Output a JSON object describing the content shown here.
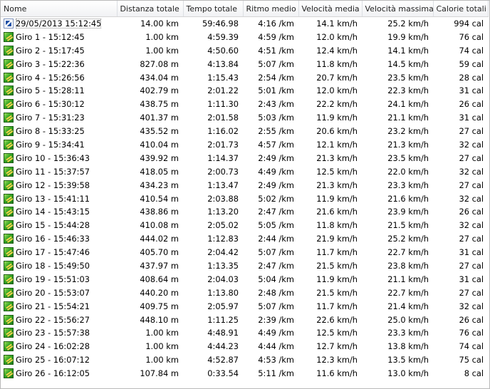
{
  "columns": [
    "Nome",
    "Distanza totale",
    "Tempo totale",
    "Ritmo medio",
    "Velocità media",
    "Velocità massima",
    "Calorie totali"
  ],
  "rows": [
    {
      "name": "29/05/2013 15:12:45",
      "dist": "14.00 km",
      "time": "59:46.98",
      "pace": "4:16 /km",
      "avg": "14.1 km/h",
      "max": "25.2 km/h",
      "cal": "994 cal",
      "icon": "runner-icon"
    },
    {
      "name": "Giro 1 - 15:12:45",
      "dist": "1.00 km",
      "time": "4:59.39",
      "pace": "4:59 /km",
      "avg": "12.0 km/h",
      "max": "19.9 km/h",
      "cal": "76 cal",
      "icon": "lap-icon"
    },
    {
      "name": "Giro 2 - 15:17:45",
      "dist": "1.00 km",
      "time": "4:50.60",
      "pace": "4:51 /km",
      "avg": "12.4 km/h",
      "max": "14.1 km/h",
      "cal": "74 cal",
      "icon": "lap-icon"
    },
    {
      "name": "Giro 3 - 15:22:36",
      "dist": "827.08 m",
      "time": "4:13.84",
      "pace": "5:07 /km",
      "avg": "11.8 km/h",
      "max": "14.5 km/h",
      "cal": "59 cal",
      "icon": "lap-icon"
    },
    {
      "name": "Giro 4 - 15:26:56",
      "dist": "434.04 m",
      "time": "1:15.43",
      "pace": "2:54 /km",
      "avg": "20.7 km/h",
      "max": "23.5 km/h",
      "cal": "28 cal",
      "icon": "lap-icon"
    },
    {
      "name": "Giro 5 - 15:28:11",
      "dist": "402.79 m",
      "time": "2:01.22",
      "pace": "5:01 /km",
      "avg": "12.0 km/h",
      "max": "22.3 km/h",
      "cal": "31 cal",
      "icon": "lap-icon"
    },
    {
      "name": "Giro 6 - 15:30:12",
      "dist": "438.75 m",
      "time": "1:11.30",
      "pace": "2:43 /km",
      "avg": "22.2 km/h",
      "max": "24.1 km/h",
      "cal": "26 cal",
      "icon": "lap-icon"
    },
    {
      "name": "Giro 7 - 15:31:23",
      "dist": "401.37 m",
      "time": "2:01.58",
      "pace": "5:03 /km",
      "avg": "11.9 km/h",
      "max": "21.1 km/h",
      "cal": "31 cal",
      "icon": "lap-icon"
    },
    {
      "name": "Giro 8 - 15:33:25",
      "dist": "435.52 m",
      "time": "1:16.02",
      "pace": "2:55 /km",
      "avg": "20.6 km/h",
      "max": "23.2 km/h",
      "cal": "27 cal",
      "icon": "lap-icon"
    },
    {
      "name": "Giro 9 - 15:34:41",
      "dist": "410.04 m",
      "time": "2:01.73",
      "pace": "4:57 /km",
      "avg": "12.1 km/h",
      "max": "21.3 km/h",
      "cal": "32 cal",
      "icon": "lap-icon"
    },
    {
      "name": "Giro 10 - 15:36:43",
      "dist": "439.92 m",
      "time": "1:14.37",
      "pace": "2:49 /km",
      "avg": "21.3 km/h",
      "max": "23.5 km/h",
      "cal": "27 cal",
      "icon": "lap-icon"
    },
    {
      "name": "Giro 11 - 15:37:57",
      "dist": "418.05 m",
      "time": "2:00.73",
      "pace": "4:49 /km",
      "avg": "12.5 km/h",
      "max": "22.0 km/h",
      "cal": "32 cal",
      "icon": "lap-icon"
    },
    {
      "name": "Giro 12 - 15:39:58",
      "dist": "434.23 m",
      "time": "1:13.47",
      "pace": "2:49 /km",
      "avg": "21.3 km/h",
      "max": "23.3 km/h",
      "cal": "27 cal",
      "icon": "lap-icon"
    },
    {
      "name": "Giro 13 - 15:41:11",
      "dist": "410.54 m",
      "time": "2:03.88",
      "pace": "5:02 /km",
      "avg": "11.9 km/h",
      "max": "21.6 km/h",
      "cal": "32 cal",
      "icon": "lap-icon"
    },
    {
      "name": "Giro 14 - 15:43:15",
      "dist": "438.86 m",
      "time": "1:13.20",
      "pace": "2:47 /km",
      "avg": "21.6 km/h",
      "max": "23.9 km/h",
      "cal": "26 cal",
      "icon": "lap-icon"
    },
    {
      "name": "Giro 15 - 15:44:28",
      "dist": "410.08 m",
      "time": "2:05.02",
      "pace": "5:05 /km",
      "avg": "11.8 km/h",
      "max": "21.5 km/h",
      "cal": "32 cal",
      "icon": "lap-icon"
    },
    {
      "name": "Giro 16 - 15:46:33",
      "dist": "444.02 m",
      "time": "1:12.83",
      "pace": "2:44 /km",
      "avg": "21.9 km/h",
      "max": "25.2 km/h",
      "cal": "27 cal",
      "icon": "lap-icon"
    },
    {
      "name": "Giro 17 - 15:47:46",
      "dist": "405.70 m",
      "time": "2:04.42",
      "pace": "5:07 /km",
      "avg": "11.7 km/h",
      "max": "22.7 km/h",
      "cal": "31 cal",
      "icon": "lap-icon"
    },
    {
      "name": "Giro 18 - 15:49:50",
      "dist": "437.97 m",
      "time": "1:13.35",
      "pace": "2:47 /km",
      "avg": "21.5 km/h",
      "max": "23.8 km/h",
      "cal": "27 cal",
      "icon": "lap-icon"
    },
    {
      "name": "Giro 19 - 15:51:03",
      "dist": "408.64 m",
      "time": "2:04.03",
      "pace": "5:04 /km",
      "avg": "11.9 km/h",
      "max": "21.1 km/h",
      "cal": "31 cal",
      "icon": "lap-icon"
    },
    {
      "name": "Giro 20 - 15:53:07",
      "dist": "440.20 m",
      "time": "1:13.80",
      "pace": "2:48 /km",
      "avg": "21.5 km/h",
      "max": "22.7 km/h",
      "cal": "27 cal",
      "icon": "lap-icon"
    },
    {
      "name": "Giro 21 - 15:54:21",
      "dist": "409.75 m",
      "time": "2:05.97",
      "pace": "5:07 /km",
      "avg": "11.7 km/h",
      "max": "21.4 km/h",
      "cal": "32 cal",
      "icon": "lap-icon"
    },
    {
      "name": "Giro 22 - 15:56:27",
      "dist": "448.10 m",
      "time": "1:11.25",
      "pace": "2:39 /km",
      "avg": "22.6 km/h",
      "max": "25.0 km/h",
      "cal": "26 cal",
      "icon": "lap-icon"
    },
    {
      "name": "Giro 23 - 15:57:38",
      "dist": "1.00 km",
      "time": "4:48.91",
      "pace": "4:49 /km",
      "avg": "12.5 km/h",
      "max": "23.3 km/h",
      "cal": "76 cal",
      "icon": "lap-icon"
    },
    {
      "name": "Giro 24 - 16:02:28",
      "dist": "1.00 km",
      "time": "4:44.23",
      "pace": "4:44 /km",
      "avg": "12.7 km/h",
      "max": "13.8 km/h",
      "cal": "74 cal",
      "icon": "lap-icon"
    },
    {
      "name": "Giro 25 - 16:07:12",
      "dist": "1.00 km",
      "time": "4:52.87",
      "pace": "4:53 /km",
      "avg": "12.3 km/h",
      "max": "13.5 km/h",
      "cal": "75 cal",
      "icon": "lap-icon"
    },
    {
      "name": "Giro 26 - 16:12:05",
      "dist": "107.84 m",
      "time": "0:33.54",
      "pace": "5:11 /km",
      "avg": "11.6 km/h",
      "max": "13.0 km/h",
      "cal": "8 cal",
      "icon": "lap-icon"
    }
  ]
}
